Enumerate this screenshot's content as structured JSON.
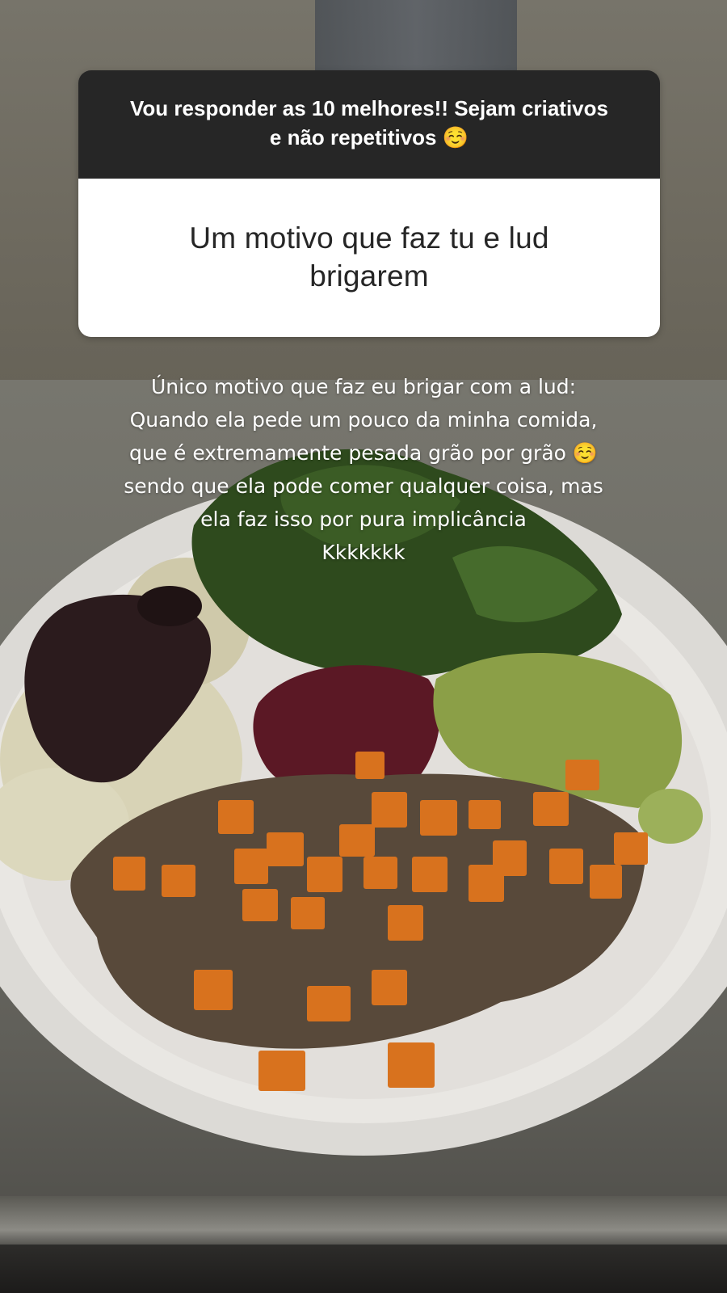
{
  "question_sticker": {
    "prompt": "Vou responder as 10 melhores!! Sejam criativos e não repetitivos ☺️",
    "question": "Um motivo que faz tu e lud brigarem"
  },
  "answer": {
    "lines": [
      "Único motivo que faz eu brigar com a lud:",
      "Quando ela pede um pouco da minha comida,",
      "que é extremamente pesada grão por grão ☺️",
      "sendo que ela pode comer qualquer coisa, mas",
      "ela faz isso por pura implicância",
      "Kkkkkkk"
    ]
  },
  "background_photo": {
    "subject": "plate-of-food",
    "colors": {
      "wall": "#6e6a5f",
      "table": "#6c6b64",
      "plate": "#e9e7e3",
      "kale": "#2f4a1e",
      "carrot": "#d9741f",
      "ground_beef": "#5a4a3a",
      "beet": "#5e1a26",
      "mashed_potato": "#d9d4b8",
      "zucchini": "#8fa24a",
      "sauce": "#2a1a1c"
    }
  }
}
